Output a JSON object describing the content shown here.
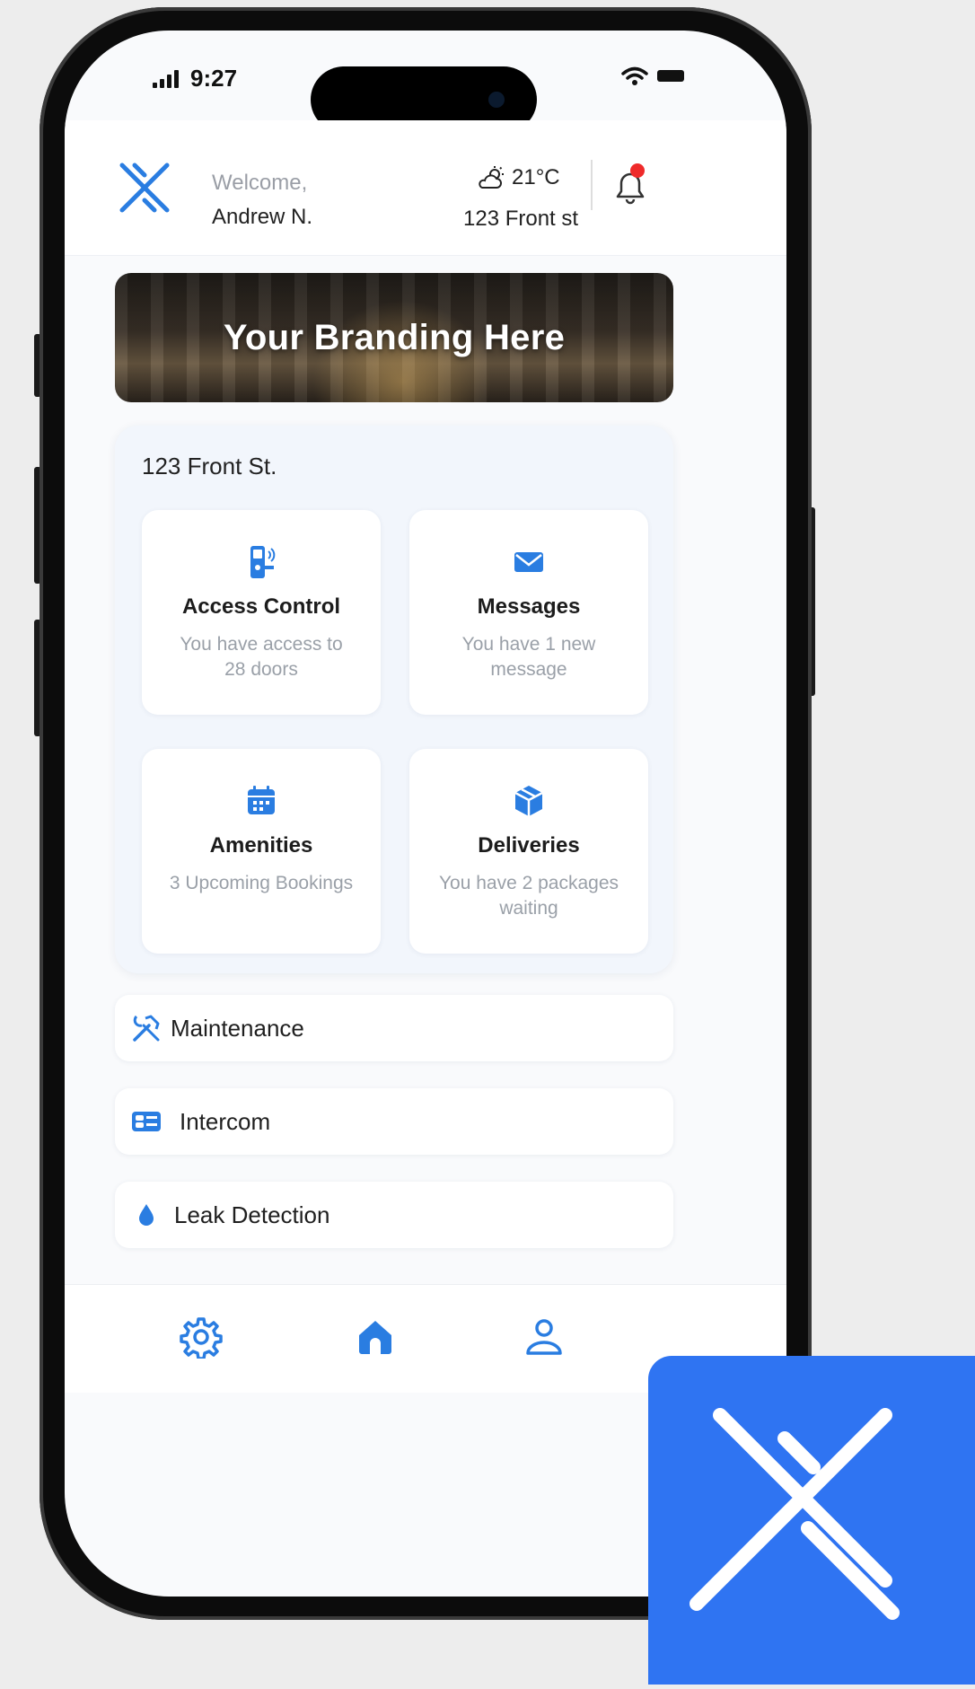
{
  "status_bar": {
    "time": "9:27"
  },
  "header": {
    "welcome": "Welcome,",
    "user_name": "Andrew N.",
    "temperature": "21°C",
    "address": "123 Front st"
  },
  "banner": {
    "text": "Your Branding Here"
  },
  "property": {
    "title": "123 Front St.",
    "tiles": [
      {
        "title": "Access Control",
        "subtitle": "You have access to 28 doors",
        "icon": "door-lock-icon"
      },
      {
        "title": "Messages",
        "subtitle": "You have 1 new message",
        "icon": "envelope-icon"
      },
      {
        "title": "Amenities",
        "subtitle": "3 Upcoming Bookings",
        "icon": "calendar-icon"
      },
      {
        "title": "Deliveries",
        "subtitle": "You have 2 packages waiting",
        "icon": "package-icon"
      }
    ]
  },
  "list": [
    {
      "label": "Maintenance",
      "icon": "tools-icon"
    },
    {
      "label": "Intercom",
      "icon": "intercom-icon"
    },
    {
      "label": "Leak Detection",
      "icon": "water-drop-icon"
    }
  ],
  "tabbar": {
    "items": [
      "settings-icon",
      "home-icon",
      "profile-icon"
    ]
  },
  "colors": {
    "accent": "#2f74f2",
    "icon_blue": "#2a7de1",
    "notification": "#ef2a2a"
  }
}
